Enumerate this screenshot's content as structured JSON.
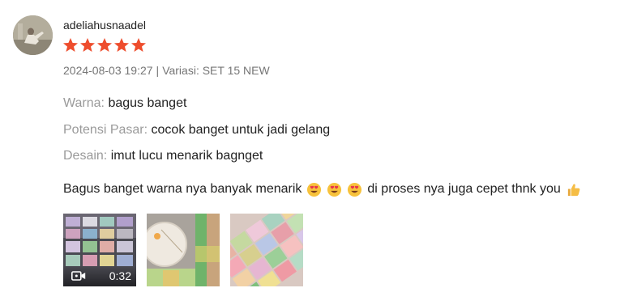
{
  "review": {
    "username": "adeliahusnaadel",
    "rating": 5,
    "rating_max": 5,
    "timestamp": "2024-08-03 19:27",
    "separator": "|",
    "variation": "Variasi: SET 15 NEW",
    "attributes": [
      {
        "label": "Warna:",
        "value": "bagus banget"
      },
      {
        "label": "Potensi Pasar:",
        "value": "cocok banget untuk jadi gelang"
      },
      {
        "label": "Desain:",
        "value": "imut lucu menarik bagnget"
      }
    ],
    "comment_before": "Bagus banget warna nya banyak menarik",
    "comment_emojis": [
      "smiling-face-with-heart-eyes-icon",
      "smiling-face-with-heart-eyes-icon",
      "smiling-face-with-heart-eyes-icon"
    ],
    "comment_after": "di proses nya juga cepet thnk you",
    "comment_end_emoji": "thumbs-up-icon",
    "media": [
      {
        "type": "video",
        "duration": "0:32",
        "icon": "video-camera-icon"
      },
      {
        "type": "image"
      },
      {
        "type": "image"
      }
    ]
  },
  "colors": {
    "star": "#ee4d2d",
    "muted_text": "#757575",
    "label_text": "#9a9a9a",
    "body_text": "#222222"
  }
}
